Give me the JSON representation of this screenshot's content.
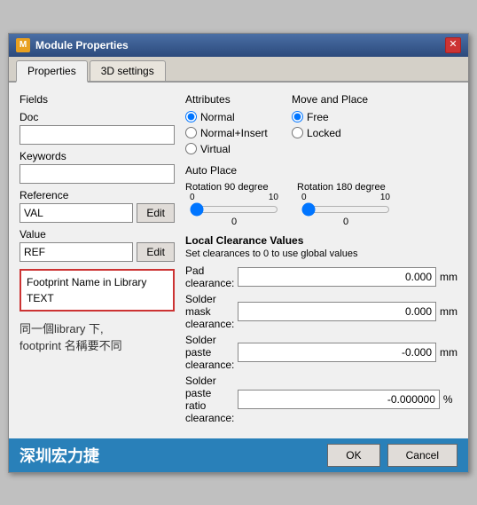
{
  "window": {
    "title": "Module Properties",
    "icon_label": "M"
  },
  "tabs": [
    {
      "label": "Properties",
      "active": true
    },
    {
      "label": "3D settings",
      "active": false
    }
  ],
  "left": {
    "fields_label": "Fields",
    "doc_label": "Doc",
    "doc_value": "",
    "keywords_label": "Keywords",
    "keywords_value": "",
    "reference_label": "Reference",
    "reference_value": "VAL",
    "reference_edit": "Edit",
    "value_label": "Value",
    "value_value": "REF",
    "value_edit": "Edit",
    "footprint_label": "Footprint Name in Library",
    "footprint_value": "TEXT",
    "annotation_line1": "同一個library 下,",
    "annotation_line2": "footprint 名稱要不同",
    "bottom_text": "深圳宏力捷"
  },
  "attributes": {
    "title": "Attributes",
    "options": [
      {
        "label": "Normal",
        "checked": true
      },
      {
        "label": "Normal+Insert",
        "checked": false
      },
      {
        "label": "Virtual",
        "checked": false
      }
    ]
  },
  "move_and_place": {
    "title": "Move and Place",
    "options": [
      {
        "label": "Free",
        "checked": true
      },
      {
        "label": "Locked",
        "checked": false
      }
    ]
  },
  "auto_place": {
    "title": "Auto Place",
    "rotation90": {
      "label": "Rotation 90 degree",
      "min": "0",
      "max": "10",
      "value": 0
    },
    "rotation180": {
      "label": "Rotation 180 degree",
      "min": "0",
      "max": "10",
      "value": 0
    }
  },
  "clearance": {
    "section_title": "Local Clearance Values",
    "subtitle": "Set clearances to 0 to use global values",
    "rows": [
      {
        "name": "Pad clearance:",
        "value": "0.000",
        "unit": "mm"
      },
      {
        "name": "Solder mask clearance:",
        "value": "0.000",
        "unit": "mm"
      },
      {
        "name": "Solder paste clearance:",
        "value": "-0.000",
        "unit": "mm"
      },
      {
        "name": "Solder paste ratio clearance:",
        "value": "-0.000000",
        "unit": "%"
      }
    ]
  },
  "buttons": {
    "ok": "OK",
    "cancel": "Cancel"
  }
}
